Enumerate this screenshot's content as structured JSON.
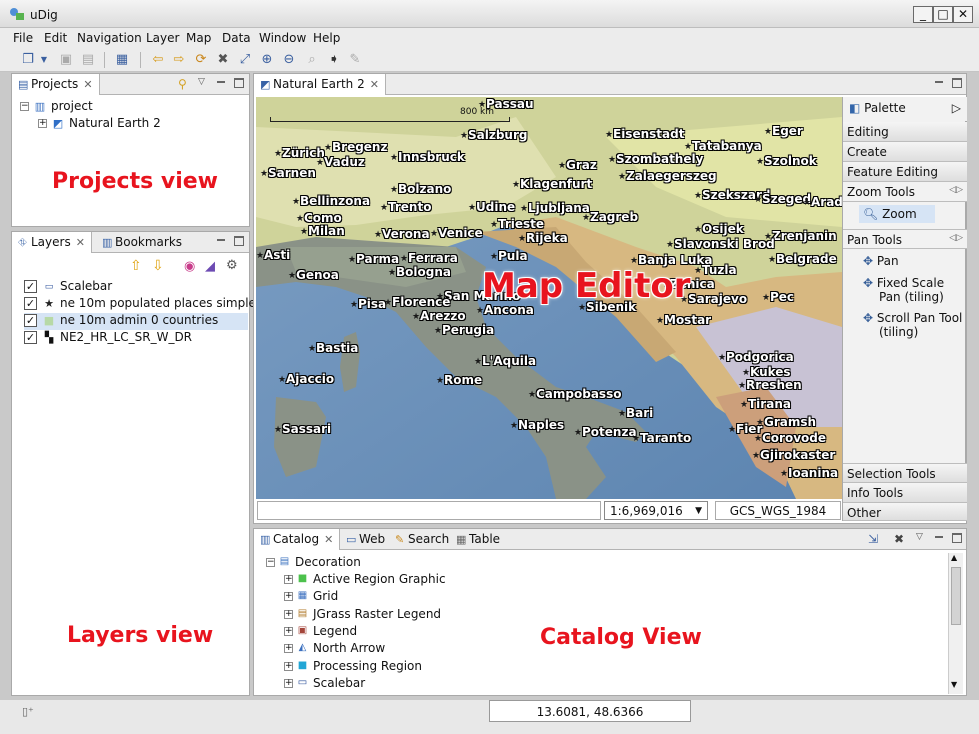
{
  "window": {
    "title": "uDig"
  },
  "menu": [
    "File",
    "Edit",
    "Navigation",
    "Layer",
    "Map",
    "Data",
    "Window",
    "Help"
  ],
  "projects_view": {
    "tab_label": "Projects",
    "tree": {
      "root": "project",
      "child": "Natural Earth 2"
    }
  },
  "layers_view": {
    "tabs": [
      "Layers",
      "Bookmarks"
    ],
    "layers": [
      {
        "label": "Scalebar",
        "checked": true
      },
      {
        "label": "ne 10m populated places simple",
        "checked": true
      },
      {
        "label": "ne 10m admin 0 countries",
        "checked": true
      },
      {
        "label": "NE2_HR_LC_SR_W_DR",
        "checked": true
      }
    ]
  },
  "map_editor": {
    "tab_label": "Natural Earth 2",
    "scalebar_label": "800 km",
    "scale_value": "1:6,969,016",
    "crs": "GCS_WGS_1984",
    "cities": [
      "Passau",
      "Salzburg",
      "Eisenstadt",
      "Eger",
      "Zürich",
      "Bregenz",
      "Vaduz",
      "Innsbruck",
      "Tatabanya",
      "Graz",
      "Szombathely",
      "Szolnok",
      "Sarnen",
      "Zalaegerszeg",
      "Klagenfurt",
      "Bolzano",
      "Szekszard",
      "Szeged",
      "Arad",
      "Bellinzona",
      "Trento",
      "Udine",
      "Ljubljana",
      "Osijek",
      "Como",
      "Milan",
      "Trieste",
      "Zagreb",
      "Zrenjanin",
      "Verona",
      "Venice",
      "Rijeka",
      "Slavonski Brod",
      "Asti",
      "Pula",
      "Banja Luka",
      "Belgrade",
      "Parma",
      "Ferrara",
      "Tuzla",
      "Genoa",
      "Bologna",
      "Zenica",
      "Sarajevo",
      "Pec",
      "San Marino",
      "Pisa",
      "Florence",
      "Ancona",
      "Sibenik",
      "Arezzo",
      "Mostar",
      "Perugia",
      "Podgorica",
      "Bastia",
      "L'Aquila",
      "Kukes",
      "Ajaccio",
      "Rome",
      "Rreshen",
      "Campobasso",
      "Tirana",
      "Bari",
      "Sassari",
      "Naples",
      "Fier",
      "Gramsh",
      "Potenza",
      "Taranto",
      "Corovode",
      "Gjirokaster",
      "Ioanina"
    ]
  },
  "palette": {
    "title": "Palette",
    "categories_top": [
      "Editing",
      "Create",
      "Feature Editing"
    ],
    "zoom_tools": {
      "header": "Zoom Tools",
      "items": [
        "Zoom"
      ]
    },
    "pan_tools": {
      "header": "Pan Tools",
      "items": [
        "Pan",
        "Fixed Scale Pan (tiling)",
        "Scroll Pan Tool (tiling)"
      ]
    },
    "categories_bottom": [
      "Selection Tools",
      "Info Tools",
      "Other"
    ]
  },
  "catalog_view": {
    "tabs": [
      "Catalog",
      "Web",
      "Search",
      "Table"
    ],
    "root": "Decoration",
    "items": [
      "Active Region Graphic",
      "Grid",
      "JGrass Raster Legend",
      "Legend",
      "North Arrow",
      "Processing Region",
      "Scalebar"
    ]
  },
  "status": {
    "coordinates": "13.6081, 48.6366"
  },
  "annotations": {
    "projects": "Projects view",
    "layers": "Layers view",
    "map": "Map Editor",
    "catalog": "Catalog View"
  },
  "colors": {
    "annotation_red": "#e8141e",
    "sea": "#6d93bb",
    "selection": "#d6e4f5"
  }
}
